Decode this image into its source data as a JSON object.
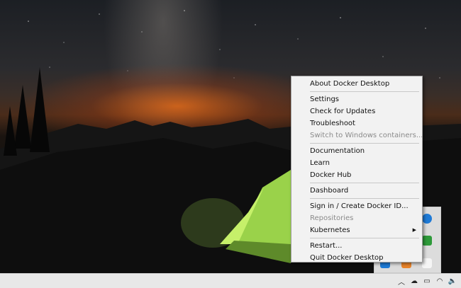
{
  "menu": {
    "items": [
      {
        "label": "About Docker Desktop",
        "enabled": true
      },
      {
        "separator": true
      },
      {
        "label": "Settings",
        "enabled": true
      },
      {
        "label": "Check for Updates",
        "enabled": true
      },
      {
        "label": "Troubleshoot",
        "enabled": true
      },
      {
        "label": "Switch to Windows containers...",
        "enabled": false
      },
      {
        "separator": true
      },
      {
        "label": "Documentation",
        "enabled": true
      },
      {
        "label": "Learn",
        "enabled": true
      },
      {
        "label": "Docker Hub",
        "enabled": true
      },
      {
        "separator": true
      },
      {
        "label": "Dashboard",
        "enabled": true
      },
      {
        "separator": true
      },
      {
        "label": "Sign in / Create Docker ID...",
        "enabled": true
      },
      {
        "label": "Repositories",
        "enabled": false
      },
      {
        "label": "Kubernetes",
        "enabled": true,
        "submenu": true
      },
      {
        "separator": true
      },
      {
        "label": "Restart...",
        "enabled": true
      },
      {
        "label": "Quit Docker Desktop",
        "enabled": true
      }
    ]
  },
  "tray_overflow": {
    "icons": [
      "bluetooth-icon",
      "security-check-icon",
      "docker-whale-icon",
      "shield-icon",
      "office-icon"
    ]
  },
  "taskbar": {
    "tray_icons": [
      "show-hidden-icons-chevron",
      "cloud-icon",
      "battery-icon",
      "wifi-icon",
      "volume-icon"
    ]
  },
  "colors": {
    "menu_bg": "#f2f2f2",
    "disabled_text": "#8a8a8a",
    "taskbar_bg": "#e8e8e8",
    "bluetooth_blue": "#1e7ad6",
    "check_green": "#2e9a3a",
    "office_orange": "#e8832a"
  }
}
